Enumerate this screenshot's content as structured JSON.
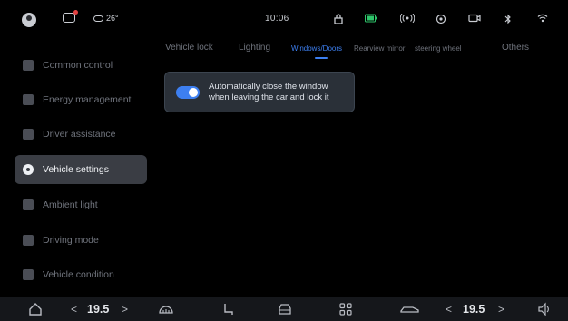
{
  "status_bar": {
    "icons": [
      "user-avatar-icon",
      "message-icon",
      "cloud-icon",
      "lock-icon",
      "battery-icon",
      "broadcast-icon",
      "location-icon",
      "camera-icon",
      "bluetooth-icon",
      "wifi-icon"
    ],
    "weather_temp": "26°",
    "time": "10:06",
    "battery_color": "#2ec56a"
  },
  "sidebar": {
    "items": [
      {
        "label": "Common control",
        "icon": "grid-icon"
      },
      {
        "label": "Energy management",
        "icon": "battery-icon"
      },
      {
        "label": "Driver assistance",
        "icon": "car-icon"
      },
      {
        "label": "Vehicle settings",
        "icon": "settings-icon",
        "active": true
      },
      {
        "label": "Ambient light",
        "icon": "bulb-icon"
      },
      {
        "label": "Driving mode",
        "icon": "steering-icon"
      },
      {
        "label": "Vehicle condition",
        "icon": "monitor-icon"
      }
    ]
  },
  "tabs": {
    "items": [
      {
        "label": "Vehicle lock"
      },
      {
        "label": "Lighting"
      },
      {
        "label": "Windows/Doors",
        "active": true
      },
      {
        "label": "Rearview mirror"
      },
      {
        "label": "steering wheel"
      },
      {
        "label": "Others"
      }
    ]
  },
  "settings": {
    "auto_close_window": {
      "line1": "Automatically close the window",
      "line2": "when leaving the car and lock it",
      "enabled": true
    }
  },
  "bottom_bar": {
    "left_temp": "19.5",
    "right_temp": "19.5",
    "prev_glyph": "<",
    "next_glyph": ">",
    "icons": [
      "home-icon",
      "defrost-icon",
      "seat-icon",
      "car-front-icon",
      "apps-icon",
      "car-side-icon",
      "volume-icon"
    ]
  },
  "colors": {
    "accent": "#3d7ff0",
    "active_item_bg": "#3a3d44",
    "card_bg": "#2a3038"
  }
}
